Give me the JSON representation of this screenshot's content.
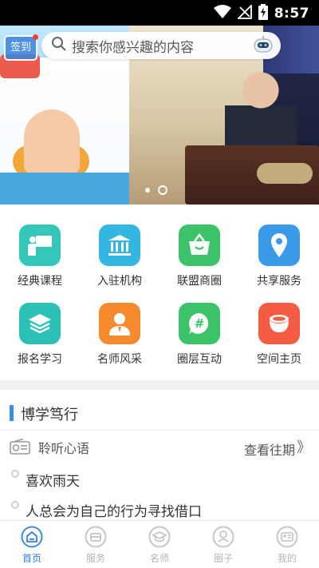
{
  "status_bar": {
    "time": "8:57"
  },
  "banner": {
    "checkin_label": "签到",
    "search_placeholder": "搜索你感兴趣的内容"
  },
  "grid": [
    {
      "label": "经典课程",
      "icon": "teacher-board-icon",
      "color": "#34c6b8"
    },
    {
      "label": "入驻机构",
      "icon": "institution-icon",
      "color": "#33b6e0"
    },
    {
      "label": "联盟商圈",
      "icon": "shopping-basket-icon",
      "color": "#3cc36a"
    },
    {
      "label": "共享服务",
      "icon": "location-pin-icon",
      "color": "#3a9ae8"
    },
    {
      "label": "报名学习",
      "icon": "layers-icon",
      "color": "#2cc0b6"
    },
    {
      "label": "名师风采",
      "icon": "person-icon",
      "color": "#f58a2f"
    },
    {
      "label": "圈层互动",
      "icon": "hashtag-chat-icon",
      "color": "#3cc36a"
    },
    {
      "label": "空间主页",
      "icon": "cup-icon",
      "color": "#f45c44"
    }
  ],
  "section": {
    "title": "博学笃行",
    "listen_label": "聆听心语",
    "history_link": "查看往期",
    "history_chevron": "》",
    "articles": [
      "喜欢雨天",
      "人总会为自己的行为寻找借口"
    ]
  },
  "tabs": [
    {
      "label": "首页",
      "active": true
    },
    {
      "label": "服务",
      "active": false
    },
    {
      "label": "名师",
      "active": false
    },
    {
      "label": "圈子",
      "active": false
    },
    {
      "label": "我的",
      "active": false
    }
  ],
  "colors": {
    "accent": "#2f7fd8",
    "section_bar": "#3a8ee6"
  }
}
